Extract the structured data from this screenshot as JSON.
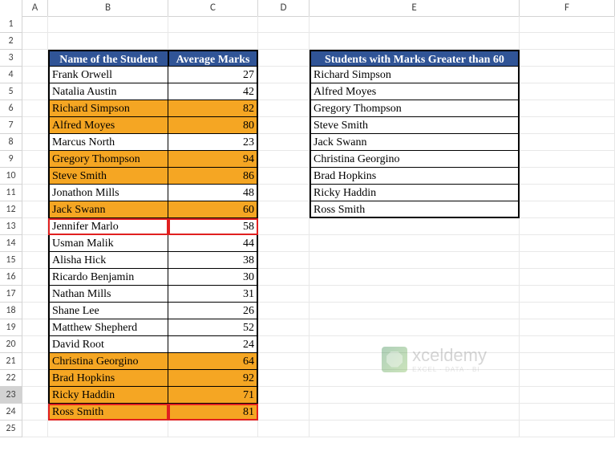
{
  "columns": [
    "A",
    "B",
    "C",
    "D",
    "E",
    "F"
  ],
  "rows": [
    1,
    2,
    3,
    4,
    5,
    6,
    7,
    8,
    9,
    10,
    11,
    12,
    13,
    14,
    15,
    16,
    17,
    18,
    19,
    20,
    21,
    22,
    23,
    24,
    25
  ],
  "selected_row": 23,
  "table1": {
    "header": {
      "name": "Name of the Student",
      "marks": "Average Marks"
    },
    "rows": [
      {
        "name": "Frank Orwell",
        "marks": 27,
        "hl": false
      },
      {
        "name": "Natalia Austin",
        "marks": 42,
        "hl": false
      },
      {
        "name": "Richard Simpson",
        "marks": 82,
        "hl": true
      },
      {
        "name": "Alfred Moyes",
        "marks": 80,
        "hl": true
      },
      {
        "name": "Marcus North",
        "marks": 23,
        "hl": false
      },
      {
        "name": "Gregory Thompson",
        "marks": 94,
        "hl": true
      },
      {
        "name": "Steve Smith",
        "marks": 86,
        "hl": true
      },
      {
        "name": "Jonathon Mills",
        "marks": 48,
        "hl": false
      },
      {
        "name": "Jack Swann",
        "marks": 60,
        "hl": true
      },
      {
        "name": "Jennifer Marlo",
        "marks": 58,
        "hl": false,
        "red": true
      },
      {
        "name": "Usman Malik",
        "marks": 44,
        "hl": false
      },
      {
        "name": "Alisha Hick",
        "marks": 38,
        "hl": false
      },
      {
        "name": "Ricardo Benjamin",
        "marks": 30,
        "hl": false
      },
      {
        "name": "Nathan Mills",
        "marks": 31,
        "hl": false
      },
      {
        "name": "Shane Lee",
        "marks": 26,
        "hl": false
      },
      {
        "name": "Matthew Shepherd",
        "marks": 52,
        "hl": false
      },
      {
        "name": "David Root",
        "marks": 24,
        "hl": false
      },
      {
        "name": "Christina Georgino",
        "marks": 64,
        "hl": true
      },
      {
        "name": "Brad Hopkins",
        "marks": 92,
        "hl": true
      },
      {
        "name": "Ricky Haddin",
        "marks": 71,
        "hl": true
      },
      {
        "name": "Ross Smith",
        "marks": 81,
        "hl": true,
        "red": true
      }
    ]
  },
  "table2": {
    "header": "Students with Marks Greater than 60",
    "rows": [
      "Richard Simpson",
      "Alfred Moyes",
      "Gregory Thompson",
      "Steve Smith",
      "Jack Swann",
      "Christina Georgino",
      "Brad Hopkins",
      "Ricky Haddin",
      "Ross Smith"
    ]
  },
  "watermark": {
    "brand": "xceldemy",
    "sub": "EXCEL · DATA · BI"
  }
}
